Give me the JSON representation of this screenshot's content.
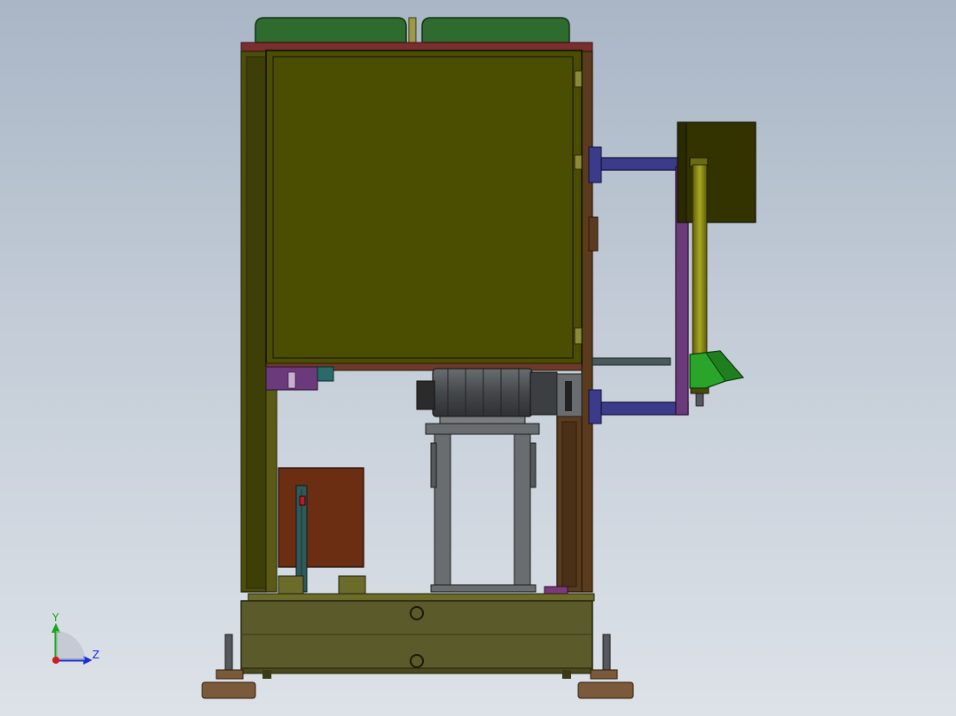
{
  "triad": {
    "y_label": "Y",
    "z_label": "Z",
    "colors": {
      "y": "#1aa51a",
      "z": "#1b2cd6",
      "x": "#d21c1c"
    }
  },
  "colors": {
    "background_top": "#a9b6c6",
    "background_bottom": "#dde2e8",
    "cabinet_panel": "#4b4d00",
    "frame_olive": "#5a5a14",
    "frame_brown": "#5a3b1e",
    "top_rail": "#7a2e2e",
    "covers_green": "#2f6b2f",
    "brown_box": "#6b2e12",
    "side_box": "#333300",
    "bracket_blue": "#3b3b8a",
    "bracket_purple": "#6b3a7a",
    "cylinder_olive": "#7d7d10",
    "guard_green": "#2aa52a",
    "motor_gray": "#55585c",
    "base_olive": "#5a5a2a",
    "feet_brown": "#7a5a3a"
  }
}
